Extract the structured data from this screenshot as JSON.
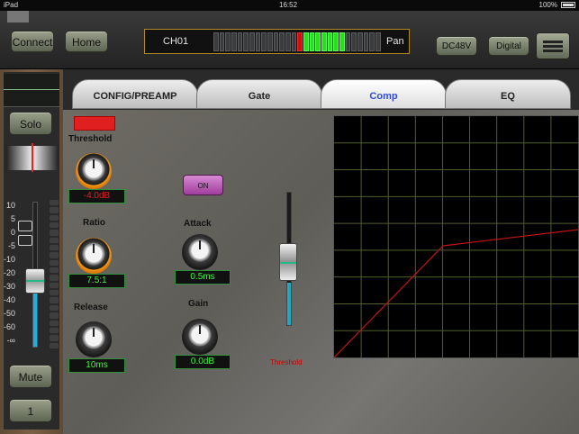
{
  "status": {
    "device": "iPad",
    "time": "16:52",
    "battery": "100%"
  },
  "header": {
    "connect_label": "Connect",
    "home_label": "Home",
    "channel_name": "CH01",
    "pan_label": "Pan",
    "dc48v_label": "DC48V",
    "digital_label": "Digital",
    "meter_segments": [
      "off",
      "off",
      "off",
      "off",
      "off",
      "off",
      "off",
      "off",
      "off",
      "off",
      "off",
      "off",
      "off",
      "off",
      "red",
      "green",
      "green",
      "green",
      "green",
      "green",
      "green",
      "green",
      "off",
      "off",
      "off",
      "off",
      "off",
      "off"
    ]
  },
  "channel_strip": {
    "solo_label": "Solo",
    "fader_scale": [
      "10",
      "5",
      "0",
      "-5",
      "-10",
      "-20",
      "-30",
      "-40",
      "-50",
      "-60",
      "-∞"
    ],
    "mute_label": "Mute",
    "channel_number": "1"
  },
  "tabs": [
    {
      "label": "CONFIG/PREAMP",
      "active": false
    },
    {
      "label": "Gate",
      "active": false
    },
    {
      "label": "Comp",
      "active": true
    },
    {
      "label": "EQ",
      "active": false
    }
  ],
  "comp": {
    "threshold_label": "Threshold",
    "threshold_value": "-4.0dB",
    "ratio_label": "Ratio",
    "ratio_value": "7.5:1",
    "release_label": "Release",
    "release_value": "10ms",
    "on_label": "ON",
    "attack_label": "Attack",
    "attack_value": "0.5ms",
    "gain_label": "Gain",
    "gain_value": "0.0dB",
    "slider_label": "Threshold",
    "curve_color": "#c01414",
    "grid_color": "#4f5f2f"
  }
}
